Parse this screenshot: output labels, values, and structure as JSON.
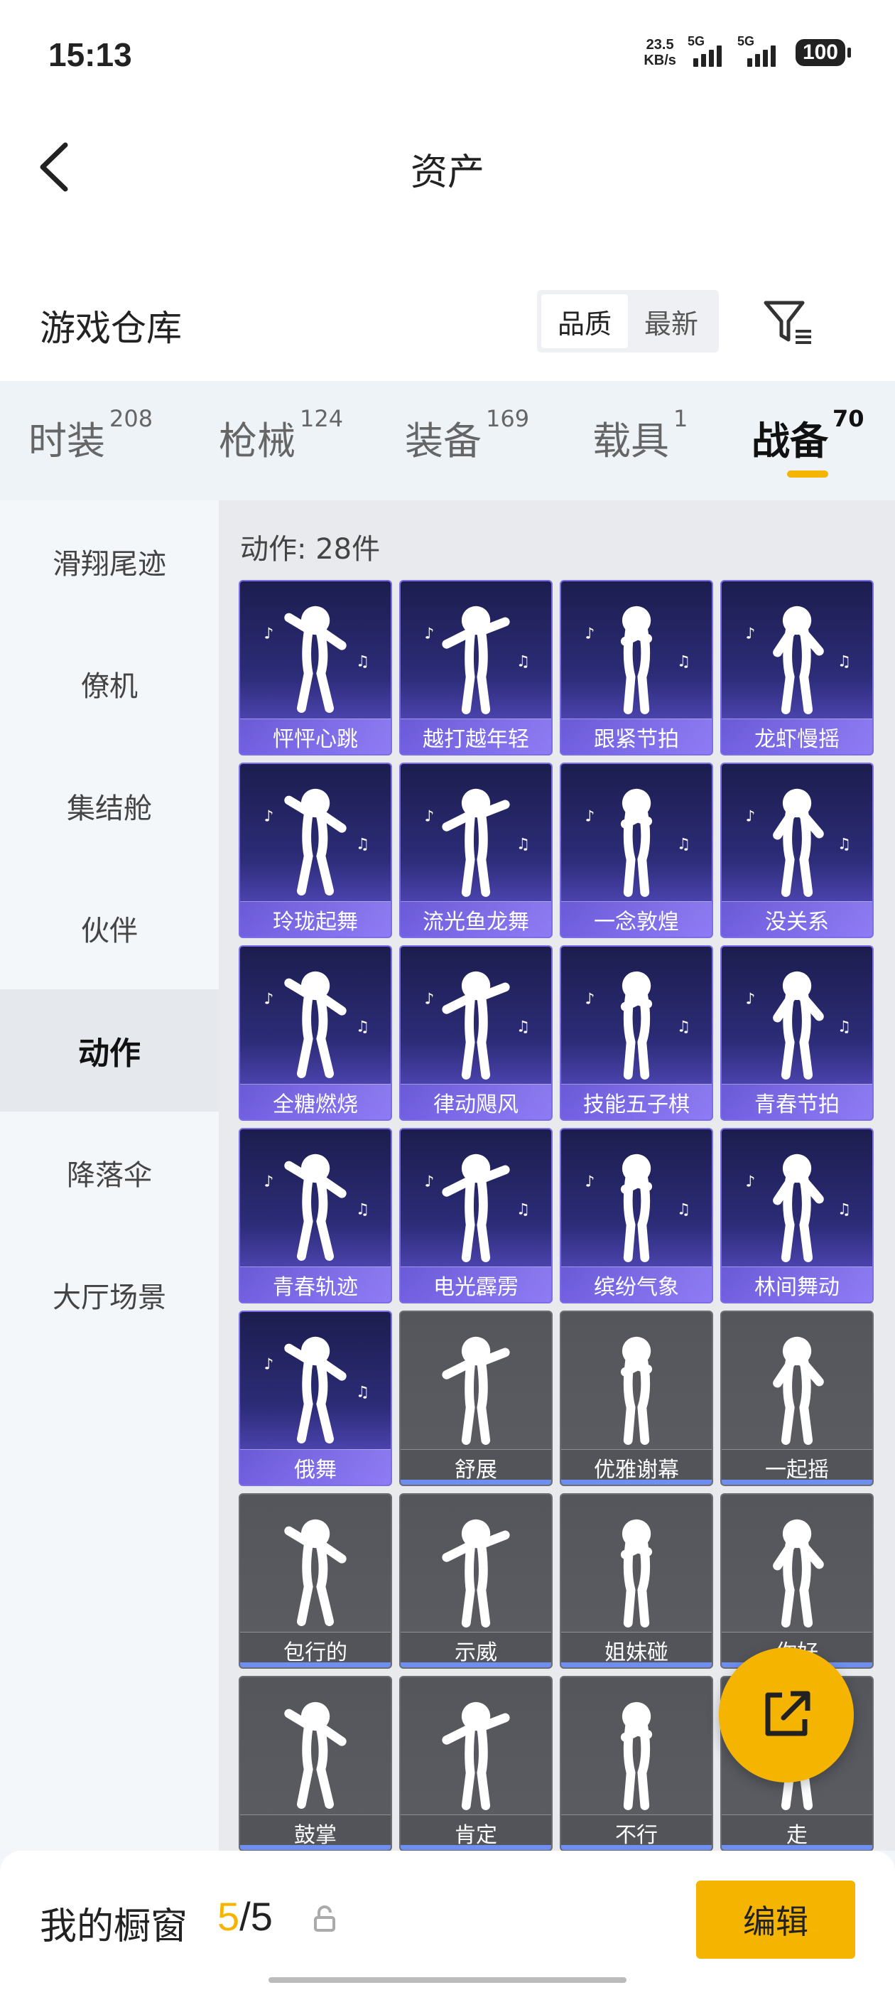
{
  "status": {
    "time": "15:13",
    "speed_value": "23.5",
    "speed_unit": "KB/s",
    "net1": "5G",
    "net2": "5G",
    "battery": "100"
  },
  "header": {
    "title": "资产"
  },
  "section": {
    "title": "游戏仓库",
    "sort_quality": "品质",
    "sort_newest": "最新"
  },
  "tabs": [
    {
      "label": "时装",
      "count": "208"
    },
    {
      "label": "枪械",
      "count": "124"
    },
    {
      "label": "装备",
      "count": "169"
    },
    {
      "label": "载具",
      "count": "1"
    },
    {
      "label": "战备",
      "count": "70"
    }
  ],
  "sidebar": [
    "滑翔尾迹",
    "僚机",
    "集结舱",
    "伙伴",
    "动作",
    "降落伞",
    "大厅场景"
  ],
  "content": {
    "count_text": "动作: 28件",
    "items": [
      {
        "label": "怦怦心跳",
        "rarity": "purple"
      },
      {
        "label": "越打越年轻",
        "rarity": "purple"
      },
      {
        "label": "跟紧节拍",
        "rarity": "purple"
      },
      {
        "label": "龙虾慢摇",
        "rarity": "purple"
      },
      {
        "label": "玲珑起舞",
        "rarity": "purple"
      },
      {
        "label": "流光鱼龙舞",
        "rarity": "purple"
      },
      {
        "label": "一念敦煌",
        "rarity": "purple"
      },
      {
        "label": "没关系",
        "rarity": "purple"
      },
      {
        "label": "全糖燃烧",
        "rarity": "purple"
      },
      {
        "label": "律动飓风",
        "rarity": "purple"
      },
      {
        "label": "技能五子棋",
        "rarity": "purple"
      },
      {
        "label": "青春节拍",
        "rarity": "purple"
      },
      {
        "label": "青春轨迹",
        "rarity": "purple"
      },
      {
        "label": "电光霹雳",
        "rarity": "purple"
      },
      {
        "label": "缤纷气象",
        "rarity": "purple"
      },
      {
        "label": "林间舞动",
        "rarity": "purple"
      },
      {
        "label": "俄舞",
        "rarity": "purple"
      },
      {
        "label": "舒展",
        "rarity": "gray"
      },
      {
        "label": "优雅谢幕",
        "rarity": "gray"
      },
      {
        "label": "一起摇",
        "rarity": "gray"
      },
      {
        "label": "包行的",
        "rarity": "gray"
      },
      {
        "label": "示威",
        "rarity": "gray"
      },
      {
        "label": "姐妹碰",
        "rarity": "gray"
      },
      {
        "label": "你好",
        "rarity": "gray"
      },
      {
        "label": "鼓掌",
        "rarity": "gray"
      },
      {
        "label": "肯定",
        "rarity": "gray"
      },
      {
        "label": "不行",
        "rarity": "gray"
      },
      {
        "label": "走",
        "rarity": "gray"
      }
    ]
  },
  "bottom": {
    "label": "我的橱窗",
    "current": "5",
    "sep_total": "/5",
    "edit_label": "编辑"
  },
  "colors": {
    "accent": "#f5b400",
    "purple_card": "#2c2c78",
    "gray_card": "#5a5c62"
  }
}
